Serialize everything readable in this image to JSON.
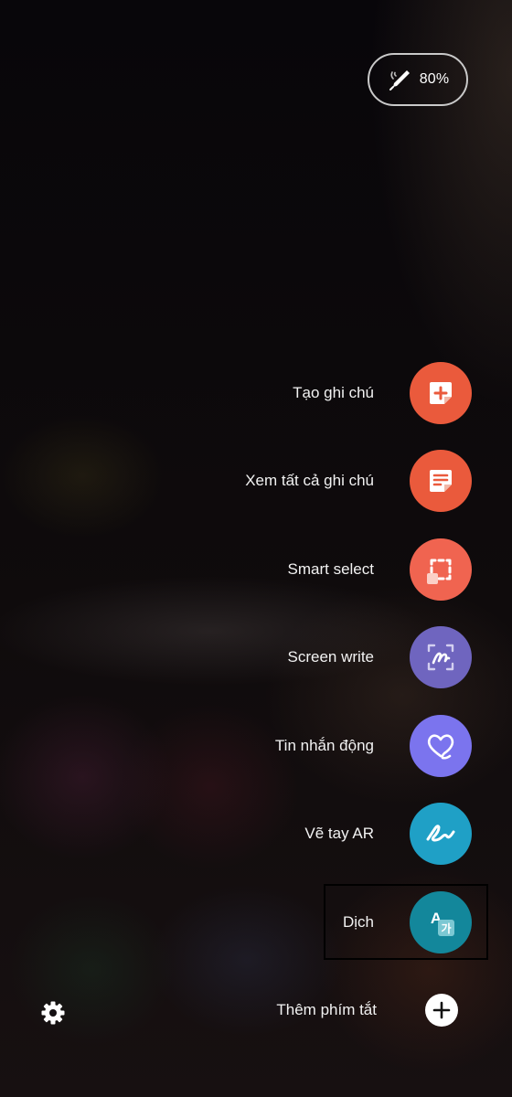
{
  "status": {
    "pen_battery": "80%"
  },
  "menu": {
    "items": [
      {
        "label": "Tạo ghi chú",
        "icon": "create-note-icon",
        "color": "#ea5a3c"
      },
      {
        "label": "Xem tất cả ghi chú",
        "icon": "view-all-notes-icon",
        "color": "#ea5a3c"
      },
      {
        "label": "Smart select",
        "icon": "smart-select-icon",
        "color": "#f06450"
      },
      {
        "label": "Screen write",
        "icon": "screen-write-icon",
        "color": "#6f65bf"
      },
      {
        "label": "Tin nhắn động",
        "icon": "live-message-icon",
        "color": "#7b74ee"
      },
      {
        "label": "Vẽ tay AR",
        "icon": "ar-doodle-icon",
        "color": "#1fa0c6"
      },
      {
        "label": "Dịch",
        "icon": "translate-icon",
        "color": "#13879b"
      }
    ],
    "add_shortcut_label": "Thêm phím tắt"
  }
}
